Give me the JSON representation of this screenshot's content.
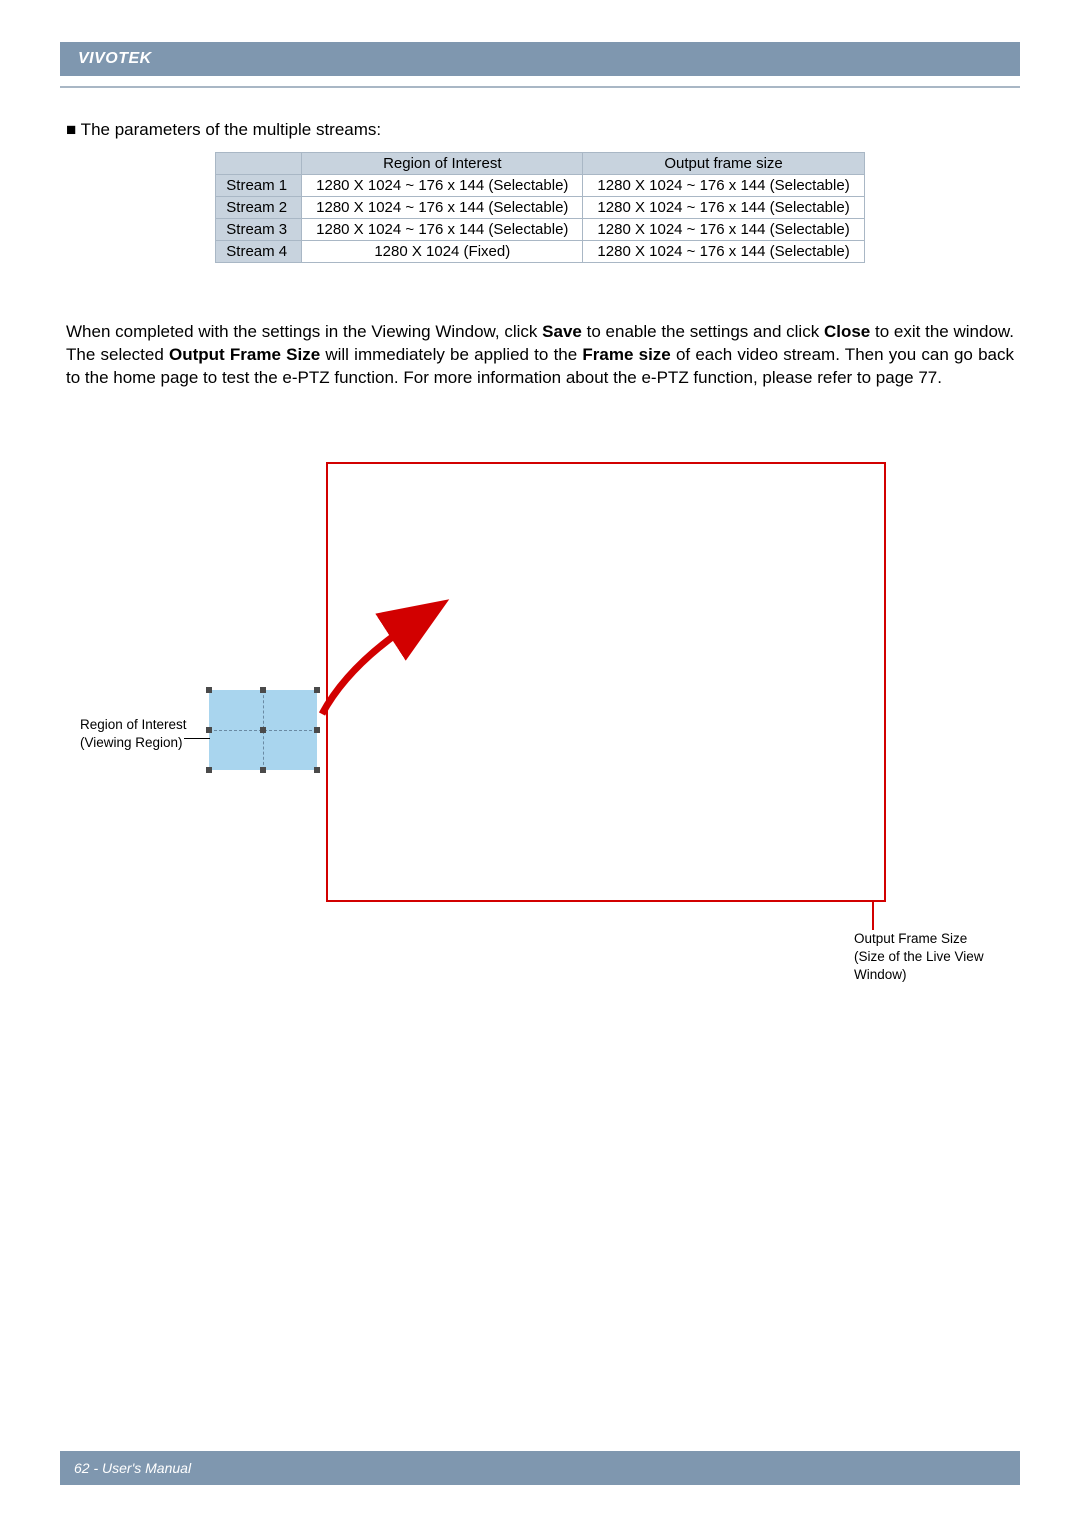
{
  "brand": "VIVOTEK",
  "footer": "62 - User's Manual",
  "bullet_line": "■ The parameters of the multiple streams:",
  "table": {
    "headers": [
      "",
      "Region of Interest",
      "Output frame size"
    ],
    "rows": [
      {
        "name": "Stream 1",
        "roi": "1280 X 1024 ~ 176 x 144 (Selectable)",
        "ofs": "1280 X 1024 ~ 176 x 144 (Selectable)"
      },
      {
        "name": "Stream 2",
        "roi": "1280 X 1024 ~ 176 x 144 (Selectable)",
        "ofs": "1280 X 1024 ~ 176 x 144 (Selectable)"
      },
      {
        "name": "Stream 3",
        "roi": "1280 X 1024 ~ 176 x 144 (Selectable)",
        "ofs": "1280 X 1024 ~ 176 x 144 (Selectable)"
      },
      {
        "name": "Stream 4",
        "roi": "1280 X 1024 (Fixed)",
        "ofs": "1280 X 1024 ~ 176 x 144 (Selectable)"
      }
    ]
  },
  "paragraph": {
    "p1a": "When completed with the settings in the Viewing Window, click ",
    "p1b": "Save",
    "p1c": " to enable the settings and click ",
    "p1d": "Close",
    "p1e": " to exit the window. The selected ",
    "p1f": "Output Frame Size",
    "p1g": " will immediately be applied to the ",
    "p1h": "Frame size",
    "p1i": " of each video stream. Then you can go back to the home page to test the e-PTZ function. For more information about the e-PTZ function, please refer to page 77."
  },
  "diagram": {
    "roi_label_1": "Region of Interest",
    "roi_label_2": "(Viewing Region)",
    "output_label_1": "Output Frame Size",
    "output_label_2": "(Size of the Live View Window)"
  }
}
